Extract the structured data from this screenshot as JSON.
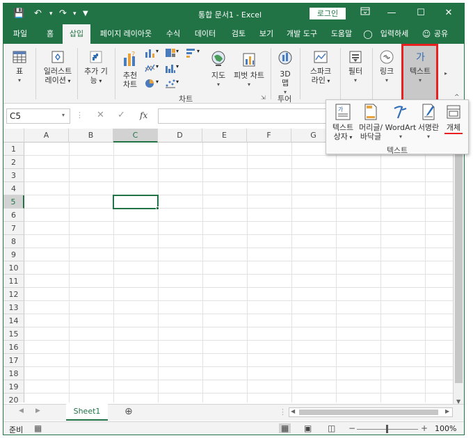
{
  "titlebar": {
    "doc_title": "통합 문서1  -  Excel",
    "login": "로그인"
  },
  "tabs": [
    {
      "label": "파일"
    },
    {
      "label": "홈"
    },
    {
      "label": "삽입",
      "active": true
    },
    {
      "label": "페이지 레이아웃"
    },
    {
      "label": "수식"
    },
    {
      "label": "데이터"
    },
    {
      "label": "검토"
    },
    {
      "label": "보기"
    },
    {
      "label": "개발 도구"
    },
    {
      "label": "도움말"
    },
    {
      "label": "입력하세"
    },
    {
      "label": "공유"
    }
  ],
  "ribbon": {
    "table": "표",
    "illustrations_1": "일러스트",
    "illustrations_2": "레이션",
    "addins_1": "추가 기",
    "addins_2": "능",
    "recommended_1": "추천",
    "recommended_2": "차트",
    "maps": "지도",
    "pivot_chart": "피벗 차트",
    "map3d_1": "3D",
    "map3d_2": "맵",
    "sparkline_1": "스파크",
    "sparkline_2": "라인",
    "filter": "필터",
    "link": "링크",
    "text": "텍스트",
    "group_charts": "차트",
    "group_tours": "투어"
  },
  "formulabar": {
    "namebox": "C5",
    "fx": "fx"
  },
  "grid": {
    "columns": [
      "A",
      "B",
      "C",
      "D",
      "E",
      "F",
      "G"
    ],
    "rows": [
      "1",
      "2",
      "3",
      "4",
      "5",
      "6",
      "7",
      "8",
      "9",
      "10",
      "11",
      "12",
      "13",
      "14",
      "15",
      "16",
      "17",
      "18",
      "19",
      "20"
    ],
    "selected_cell": "C5"
  },
  "sheets": {
    "active": "Sheet1"
  },
  "status": {
    "ready": "준비",
    "zoom": "100%"
  },
  "popup": {
    "textbox_1": "텍스트",
    "textbox_2": "상자",
    "header_1": "머리글/",
    "header_2": "바닥글",
    "wordart": "WordArt",
    "signature": "서명란",
    "object": "개체",
    "group_label": "텍스트"
  },
  "colors": {
    "accent": "#217346",
    "highlight": "#e8201f"
  }
}
